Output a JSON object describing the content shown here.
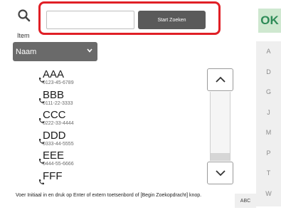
{
  "header": {
    "item_label": "Item",
    "start_search_label": "Start Zoeken",
    "search_placeholder": "",
    "ok_label": "OK"
  },
  "sort": {
    "selected": "Naam"
  },
  "alphabet_index": [
    "A",
    "D",
    "G",
    "J",
    "M",
    "P",
    "T",
    "W"
  ],
  "contacts": [
    {
      "name": "AAA",
      "number": "0123-45-6789"
    },
    {
      "name": "BBB",
      "number": "0111-22-3333"
    },
    {
      "name": "CCC",
      "number": "0222-33-4444"
    },
    {
      "name": "DDD",
      "number": "0333-44-5555"
    },
    {
      "name": "EEE",
      "number": "0444-55-6666"
    },
    {
      "name": "FFF",
      "number": ""
    }
  ],
  "footer": {
    "instruction": "Voer Initiaal in en druk op Enter of extern toetsenbord of [Begin Zoekopdracht] knop.",
    "abc_label": "ABC"
  },
  "colors": {
    "highlight_border": "#e01f26",
    "ok_background": "#cfe8d0",
    "button_dark": "#5a5a5a"
  }
}
